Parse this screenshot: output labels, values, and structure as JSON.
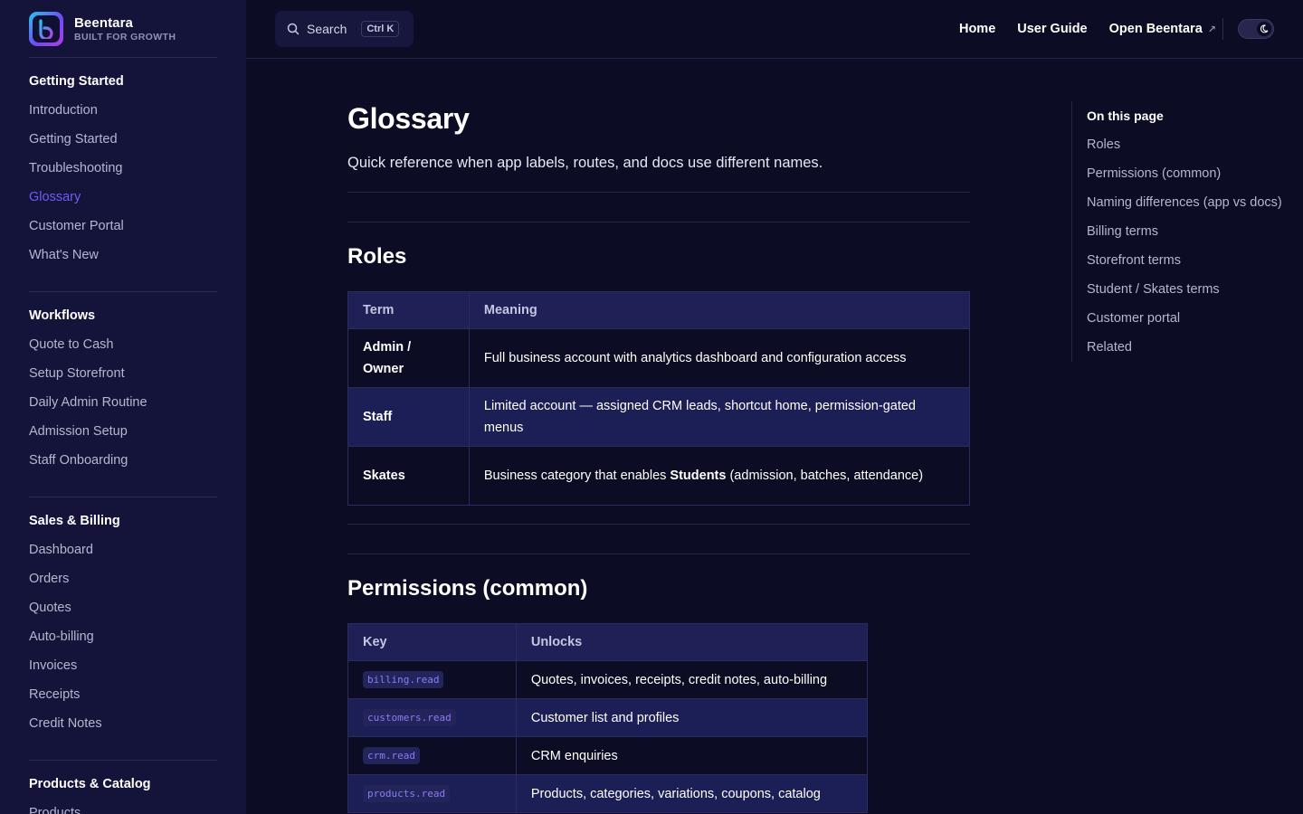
{
  "brand": {
    "name": "Beentara",
    "tagline": "BUILT FOR GROWTH"
  },
  "sidebar": {
    "groups": [
      {
        "heading": "Getting Started",
        "items": [
          "Introduction",
          "Getting Started",
          "Troubleshooting",
          "Glossary",
          "Customer Portal",
          "What's New"
        ],
        "active": "Glossary"
      },
      {
        "heading": "Workflows",
        "items": [
          "Quote to Cash",
          "Setup Storefront",
          "Daily Admin Routine",
          "Admission Setup",
          "Staff Onboarding"
        ]
      },
      {
        "heading": "Sales & Billing",
        "items": [
          "Dashboard",
          "Orders",
          "Quotes",
          "Auto-billing",
          "Invoices",
          "Receipts",
          "Credit Notes"
        ]
      },
      {
        "heading": "Products & Catalog",
        "items": [
          "Products"
        ]
      }
    ]
  },
  "topbar": {
    "search_label": "Search",
    "search_shortcut": "Ctrl K",
    "nav": {
      "home": "Home",
      "user_guide": "User Guide",
      "open_app": "Open Beentara",
      "open_app_icon": "↗"
    }
  },
  "page": {
    "title": "Glossary",
    "lead": "Quick reference when app labels, routes, and docs use different names.",
    "roles": {
      "heading": "Roles",
      "columns": [
        "Term",
        "Meaning"
      ],
      "rows": [
        {
          "term_line1": "Admin /",
          "term_line2": "Owner",
          "meaning": "Full business account with analytics dashboard and configuration access"
        },
        {
          "term": "Staff",
          "meaning": "Limited account — assigned CRM leads, shortcut home, permission-gated menus"
        },
        {
          "term": "Skates",
          "meaning_pre": "Business category that enables ",
          "meaning_bold": "Students",
          "meaning_post": " (admission, batches, attendance)"
        }
      ]
    },
    "permissions": {
      "heading": "Permissions (common)",
      "columns": [
        "Key",
        "Unlocks"
      ],
      "rows": [
        {
          "key": "billing.read",
          "unlocks": "Quotes, invoices, receipts, credit notes, auto-billing"
        },
        {
          "key": "customers.read",
          "unlocks": "Customer list and profiles"
        },
        {
          "key": "crm.read",
          "unlocks": "CRM enquiries"
        },
        {
          "key": "products.read",
          "unlocks": "Products, categories, variations, coupons, catalog"
        }
      ]
    }
  },
  "toc": {
    "title": "On this page",
    "items": [
      "Roles",
      "Permissions (common)",
      "Naming differences (app vs docs)",
      "Billing terms",
      "Storefront terms",
      "Student / Skates terms",
      "Customer portal",
      "Related"
    ]
  },
  "colors": {
    "background": "#0c0c24",
    "sidebar": "#14143a",
    "accent": "#6f5cf6",
    "table_header": "#1e2056"
  },
  "icons": {
    "search": "search-icon",
    "external": "external-link-icon",
    "theme": "moon-icon"
  }
}
